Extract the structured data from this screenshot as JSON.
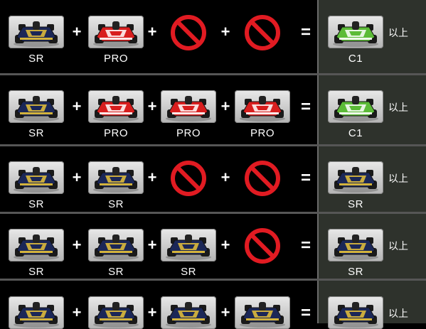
{
  "rows": [
    {
      "inputs": [
        {
          "kind": "kart",
          "label": "SR",
          "body": "#1b2757",
          "accent": "#e8c33a"
        },
        {
          "kind": "kart",
          "label": "PRO",
          "body": "#d81e1e",
          "accent": "#ffffff"
        },
        {
          "kind": "none"
        },
        {
          "kind": "none"
        }
      ],
      "operators": [
        "+",
        "+",
        "+",
        "="
      ],
      "result": {
        "label": "C1",
        "body": "#5bbb37",
        "accent": "#ffffff",
        "suffix": "以上"
      }
    },
    {
      "inputs": [
        {
          "kind": "kart",
          "label": "SR",
          "body": "#1b2757",
          "accent": "#e8c33a"
        },
        {
          "kind": "kart",
          "label": "PRO",
          "body": "#d81e1e",
          "accent": "#ffffff"
        },
        {
          "kind": "kart",
          "label": "PRO",
          "body": "#d81e1e",
          "accent": "#ffffff"
        },
        {
          "kind": "kart",
          "label": "PRO",
          "body": "#d81e1e",
          "accent": "#ffffff"
        }
      ],
      "operators": [
        "+",
        "+",
        "+",
        "="
      ],
      "result": {
        "label": "C1",
        "body": "#5bbb37",
        "accent": "#ffffff",
        "suffix": "以上"
      }
    },
    {
      "inputs": [
        {
          "kind": "kart",
          "label": "SR",
          "body": "#1b2757",
          "accent": "#e8c33a"
        },
        {
          "kind": "kart",
          "label": "SR",
          "body": "#1b2757",
          "accent": "#e8c33a"
        },
        {
          "kind": "none"
        },
        {
          "kind": "none"
        }
      ],
      "operators": [
        "+",
        "+",
        "+",
        "="
      ],
      "result": {
        "label": "SR",
        "body": "#1b2757",
        "accent": "#e8c33a",
        "suffix": "以上"
      }
    },
    {
      "inputs": [
        {
          "kind": "kart",
          "label": "SR",
          "body": "#1b2757",
          "accent": "#e8c33a"
        },
        {
          "kind": "kart",
          "label": "SR",
          "body": "#1b2757",
          "accent": "#e8c33a"
        },
        {
          "kind": "kart",
          "label": "SR",
          "body": "#1b2757",
          "accent": "#e8c33a"
        },
        {
          "kind": "none"
        }
      ],
      "operators": [
        "+",
        "+",
        "+",
        "="
      ],
      "result": {
        "label": "SR",
        "body": "#1b2757",
        "accent": "#e8c33a",
        "suffix": "以上"
      }
    },
    {
      "inputs": [
        {
          "kind": "kart",
          "label": "",
          "body": "#1b2757",
          "accent": "#e8c33a"
        },
        {
          "kind": "kart",
          "label": "",
          "body": "#1b2757",
          "accent": "#e8c33a"
        },
        {
          "kind": "kart",
          "label": "",
          "body": "#1b2757",
          "accent": "#e8c33a"
        },
        {
          "kind": "kart",
          "label": "",
          "body": "#1b2757",
          "accent": "#e8c33a"
        }
      ],
      "operators": [
        "+",
        "+",
        "+",
        "="
      ],
      "result": {
        "label": "",
        "body": "#1b2757",
        "accent": "#e8c33a",
        "suffix": "以上"
      }
    }
  ],
  "no_symbol_color": "#e11b22"
}
